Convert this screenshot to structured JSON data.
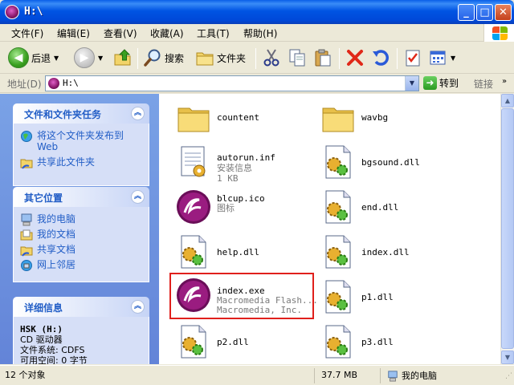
{
  "window": {
    "title": "H:\\"
  },
  "menu": [
    "文件(F)",
    "编辑(E)",
    "查看(V)",
    "收藏(A)",
    "工具(T)",
    "帮助(H)"
  ],
  "toolbar": {
    "back": "后退",
    "search": "搜索",
    "folders": "文件夹"
  },
  "address": {
    "label": "地址(D)",
    "value": "H:\\",
    "go": "转到",
    "links": "链接"
  },
  "tasks_panel": {
    "title": "文件和文件夹任务",
    "items": [
      "将这个文件夹发布到 Web",
      "共享此文件夹"
    ]
  },
  "places_panel": {
    "title": "其它位置",
    "items": [
      "我的电脑",
      "我的文档",
      "共享文档",
      "网上邻居"
    ]
  },
  "details_panel": {
    "title": "详细信息",
    "name": "HSK (H:)",
    "type": "CD 驱动器",
    "fs": "文件系统: CDFS",
    "free": "可用空间: 0 字节"
  },
  "files": [
    {
      "name": "countent",
      "icon": "folder-icon",
      "sub": []
    },
    {
      "name": "wavbg",
      "icon": "folder-icon",
      "sub": []
    },
    {
      "name": "autorun.inf",
      "icon": "text-file-icon",
      "sub": [
        "安装信息",
        "1 KB"
      ]
    },
    {
      "name": "bgsound.dll",
      "icon": "dll-gear-icon",
      "sub": []
    },
    {
      "name": "blcup.ico",
      "icon": "flash-logo-icon",
      "sub": [
        "图标"
      ]
    },
    {
      "name": "end.dll",
      "icon": "dll-gear-icon",
      "sub": []
    },
    {
      "name": "help.dll",
      "icon": "dll-gear-icon",
      "sub": []
    },
    {
      "name": "index.dll",
      "icon": "dll-gear-icon",
      "sub": []
    },
    {
      "name": "index.exe",
      "icon": "flash-logo-icon",
      "sub": [
        "Macromedia Flash...",
        "Macromedia, Inc."
      ]
    },
    {
      "name": "p1.dll",
      "icon": "dll-gear-icon",
      "sub": []
    },
    {
      "name": "p2.dll",
      "icon": "dll-gear-icon",
      "sub": []
    },
    {
      "name": "p3.dll",
      "icon": "dll-gear-icon",
      "sub": []
    }
  ],
  "status": {
    "count": "12 个对象",
    "size": "37.7 MB",
    "location": "我的电脑"
  },
  "colors": {
    "title_blue": "#0054e3",
    "task_link": "#215dc6",
    "highlight": "#e0201c"
  }
}
